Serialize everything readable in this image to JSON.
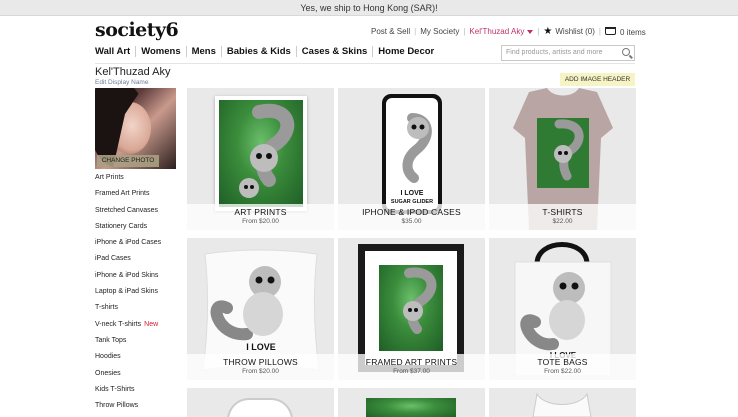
{
  "shipbar": {
    "text": "Yes, we ship to Hong Kong (SAR)!"
  },
  "logo": {
    "text": "society6"
  },
  "topnav": {
    "post_sell": "Post & Sell",
    "my_society": "My Society",
    "user": "Kel'Thuzad Aky",
    "wishlist": "Wishlist (0)",
    "cart": "0 items"
  },
  "mainnav": [
    "Wall Art",
    "Womens",
    "Mens",
    "Babies & Kids",
    "Cases & Skins",
    "Home Decor"
  ],
  "search": {
    "placeholder": "Find products, artists and more"
  },
  "profile": {
    "name": "Kel'Thuzad Aky",
    "edit_label": "Edit Display Name",
    "change_photo": "CHANGE PHOTO"
  },
  "add_header": "ADD IMAGE HEADER",
  "sidebar": [
    {
      "label": "Art Prints"
    },
    {
      "label": "Framed Art Prints"
    },
    {
      "label": "Stretched Canvases"
    },
    {
      "label": "Stationery Cards"
    },
    {
      "label": "iPhone & iPod Cases"
    },
    {
      "label": "iPad Cases"
    },
    {
      "label": "iPhone & iPod Skins"
    },
    {
      "label": "Laptop & iPad Skins"
    },
    {
      "label": "T-shirts"
    },
    {
      "label": "V-neck T-shirts",
      "badge": "New"
    },
    {
      "label": "Tank Tops"
    },
    {
      "label": "Hoodies"
    },
    {
      "label": "Onesies"
    },
    {
      "label": "Kids T-Shirts"
    },
    {
      "label": "Throw Pillows"
    }
  ],
  "products": [
    {
      "title": "ART PRINTS",
      "price": "From $20.00"
    },
    {
      "title": "IPHONE & IPOD CASES",
      "price": "$35.00"
    },
    {
      "title": "T-SHIRTS",
      "price": "$22.00"
    },
    {
      "title": "THROW PILLOWS",
      "price": "From $20.00"
    },
    {
      "title": "FRAMED ART PRINTS",
      "price": "From $37.00"
    },
    {
      "title": "TOTE BAGS",
      "price": "From $22.00"
    }
  ],
  "merch_text": {
    "line1": "I LOVE",
    "line2": "SUGAR GLIDER"
  },
  "colors": {
    "accent_user": "#c0306b",
    "new_badge": "#d02030",
    "add_header_bg": "#f6f4c4"
  }
}
